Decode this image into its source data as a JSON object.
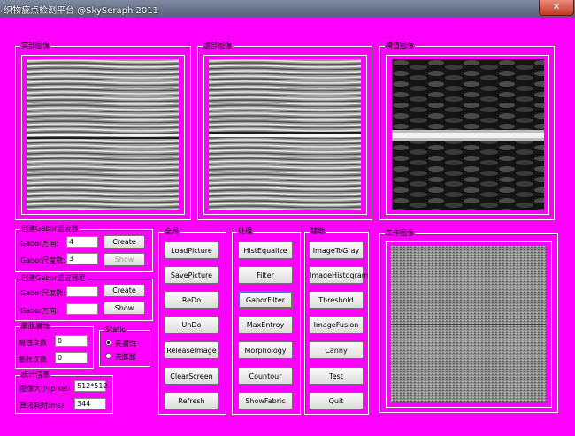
{
  "window": {
    "title": "织物疵点检测平台 @SkySeraph 2011",
    "close_label": "✕"
  },
  "images": {
    "real_label": "实部图像",
    "imag_label": "虚部图像",
    "mod_label": "模值图像",
    "work_label": "工作图像"
  },
  "gabor_filter": {
    "label": "创建Gabor滤波器",
    "dir_label": "Gabor方向:",
    "dir_value": "4",
    "scale_label": "Gabor尺度数:",
    "scale_value": "3",
    "create_label": "Create",
    "show_label": "Show"
  },
  "gabor_group": {
    "label": "创建Gabor滤波器组",
    "scale_label": "Gabor尺度数:",
    "scale_value": "",
    "dir_label": "Gabor方向:",
    "dir_value": "",
    "create_label": "Create",
    "show_label": "Show"
  },
  "morph": {
    "label": "膨胀腐蚀",
    "erode_label": "腐蚀次数",
    "erode_value": "0",
    "dilate_label": "膨胀次数",
    "dilate_value": "0"
  },
  "static": {
    "label": "Static",
    "option1": "先腐蚀",
    "option2": "先膨胀",
    "selected": "先腐蚀"
  },
  "stats": {
    "label": "统计信息",
    "size_label": "图像大小(pixel)",
    "size_value": "512*512",
    "time_label": "算法耗时(ms)",
    "time_value": "344"
  },
  "global": {
    "label": "全局",
    "buttons": [
      "LoadPicture",
      "SavePicture",
      "ReDo",
      "UnDo",
      "ReleaseImage",
      "ClearScreen",
      "Refresh"
    ]
  },
  "process": {
    "label": "处理",
    "buttons": [
      "HistEqualize",
      "Filter",
      "GaborFilter",
      "MaxEntroy",
      "Morphology",
      "Countour",
      "ShowFabric"
    ]
  },
  "assist": {
    "label": "辅助",
    "buttons": [
      "ImageToGray",
      "ImageHistogram",
      "Threshold",
      "ImageFusion",
      "Canny",
      "Test",
      "Quit"
    ]
  }
}
